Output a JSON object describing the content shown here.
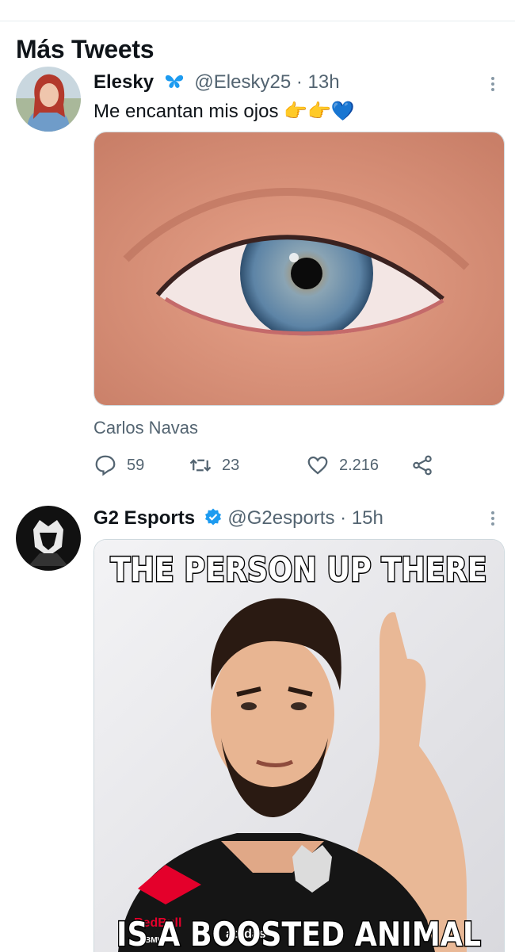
{
  "section": {
    "title": "Más Tweets"
  },
  "tweets": [
    {
      "name": "Elesky",
      "handle": "@Elesky25",
      "dot": "·",
      "time": "13h",
      "text": "Me encantan mis ojos 👉👉💙",
      "media_caption": "Carlos Navas",
      "stats": {
        "replies": "59",
        "retweets": "23",
        "likes": "2.216"
      }
    },
    {
      "name": "G2 Esports",
      "handle": "@G2esports",
      "dot": "·",
      "time": "15h",
      "meme_top": "THE PERSON UP THERE",
      "meme_bottom": "IS A BOOSTED ANIMAL",
      "shirt_sponsor_1": "RedBull",
      "shirt_sponsor_2": "adidas",
      "shirt_sponsor_3": "BMW"
    }
  ],
  "colors": {
    "text": "#0f1419",
    "muted": "#536471",
    "verified": "#1d9bf0",
    "butterfly": "#1d9bf0"
  },
  "icons": [
    "butterfly-icon",
    "verified-badge-icon",
    "reply-icon",
    "retweet-icon",
    "like-icon",
    "share-icon",
    "more-options-icon"
  ]
}
